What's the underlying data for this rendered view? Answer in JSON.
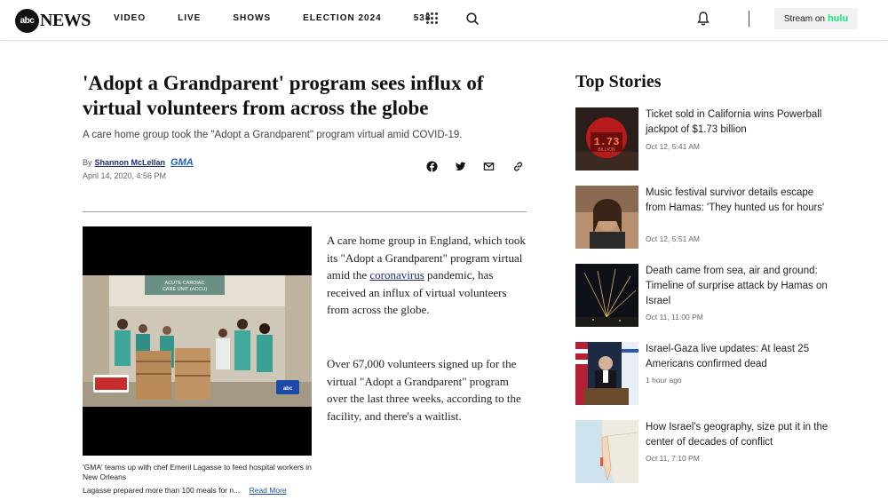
{
  "header": {
    "logo_mark": "abc",
    "logo_text": "NEWS",
    "nav": [
      "VIDEO",
      "LIVE",
      "SHOWS",
      "ELECTION 2024",
      "538"
    ],
    "stream_label": "Stream on",
    "stream_brand": "hulu"
  },
  "article": {
    "headline": "'Adopt a Grandparent' program sees influx of virtual volunteers from across the globe",
    "subhead": "A care home group took the \"Adopt a Grandparent\" program virtual amid COVID-19.",
    "by_prefix": "By",
    "author": "Shannon McLellan",
    "source_badge": "GMA",
    "date": "April 14, 2020, 4:56 PM",
    "video_sign_line1": "ACUTE CARDIAC",
    "video_sign_line2": "CARE UNIT (ACCU)",
    "video_badge": "abc",
    "caption_line": "'GMA' teams up with chef Emeril Lagasse to feed hospital workers in New Orleans",
    "caption_more": "Lagasse prepared more than 100 meals for n...",
    "read_more": "Read More",
    "p1_before": "A care home group in England, which took its \"Adopt a Grandparent\" program virtual amid the ",
    "p1_link": "coronavirus",
    "p1_after": " pandemic, has received an influx of virtual volunteers from across the globe.",
    "p2": "Over 67,000 volunteers signed up for the virtual \"Adopt a Grandparent\" program over the last three weeks, according to the facility, and there's a waitlist."
  },
  "top_stories": {
    "title": "Top Stories",
    "items": [
      {
        "headline": "Ticket sold in California wins Powerball jackpot of $1.73 billion",
        "time": "Oct 12, 5:41 AM",
        "thumb_text1": "1.73",
        "thumb_text2": "BILLION"
      },
      {
        "headline": "Music festival survivor details escape from Hamas: 'They hunted us for hours'",
        "time": "Oct 12, 5:51 AM"
      },
      {
        "headline": "Death came from sea, air and ground: Timeline of surprise attack by Hamas on Israel",
        "time": "Oct 11, 11:00 PM"
      },
      {
        "headline": "Israel-Gaza live updates: At least 25 Americans confirmed dead",
        "time": "1 hour ago"
      },
      {
        "headline": "How Israel's geography, size put it in the center of decades of conflict",
        "time": "Oct 11, 7:10 PM"
      }
    ]
  },
  "colors": {
    "link": "#1a2e6e",
    "hulu": "#1ce783",
    "gma": "#1d5fbf"
  }
}
